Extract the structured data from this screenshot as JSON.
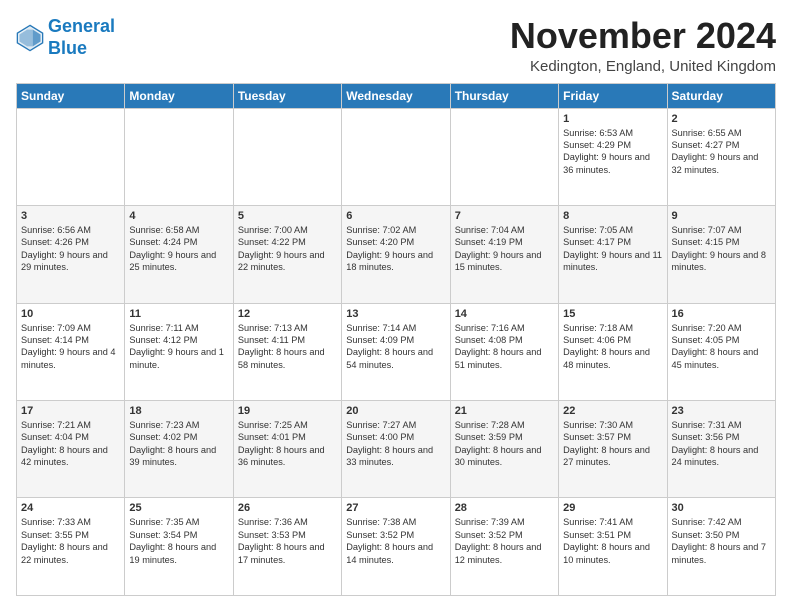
{
  "logo": {
    "line1": "General",
    "line2": "Blue"
  },
  "title": "November 2024",
  "location": "Kedington, England, United Kingdom",
  "weekdays": [
    "Sunday",
    "Monday",
    "Tuesday",
    "Wednesday",
    "Thursday",
    "Friday",
    "Saturday"
  ],
  "weeks": [
    [
      {
        "day": "",
        "info": ""
      },
      {
        "day": "",
        "info": ""
      },
      {
        "day": "",
        "info": ""
      },
      {
        "day": "",
        "info": ""
      },
      {
        "day": "",
        "info": ""
      },
      {
        "day": "1",
        "info": "Sunrise: 6:53 AM\nSunset: 4:29 PM\nDaylight: 9 hours and 36 minutes."
      },
      {
        "day": "2",
        "info": "Sunrise: 6:55 AM\nSunset: 4:27 PM\nDaylight: 9 hours and 32 minutes."
      }
    ],
    [
      {
        "day": "3",
        "info": "Sunrise: 6:56 AM\nSunset: 4:26 PM\nDaylight: 9 hours and 29 minutes."
      },
      {
        "day": "4",
        "info": "Sunrise: 6:58 AM\nSunset: 4:24 PM\nDaylight: 9 hours and 25 minutes."
      },
      {
        "day": "5",
        "info": "Sunrise: 7:00 AM\nSunset: 4:22 PM\nDaylight: 9 hours and 22 minutes."
      },
      {
        "day": "6",
        "info": "Sunrise: 7:02 AM\nSunset: 4:20 PM\nDaylight: 9 hours and 18 minutes."
      },
      {
        "day": "7",
        "info": "Sunrise: 7:04 AM\nSunset: 4:19 PM\nDaylight: 9 hours and 15 minutes."
      },
      {
        "day": "8",
        "info": "Sunrise: 7:05 AM\nSunset: 4:17 PM\nDaylight: 9 hours and 11 minutes."
      },
      {
        "day": "9",
        "info": "Sunrise: 7:07 AM\nSunset: 4:15 PM\nDaylight: 9 hours and 8 minutes."
      }
    ],
    [
      {
        "day": "10",
        "info": "Sunrise: 7:09 AM\nSunset: 4:14 PM\nDaylight: 9 hours and 4 minutes."
      },
      {
        "day": "11",
        "info": "Sunrise: 7:11 AM\nSunset: 4:12 PM\nDaylight: 9 hours and 1 minute."
      },
      {
        "day": "12",
        "info": "Sunrise: 7:13 AM\nSunset: 4:11 PM\nDaylight: 8 hours and 58 minutes."
      },
      {
        "day": "13",
        "info": "Sunrise: 7:14 AM\nSunset: 4:09 PM\nDaylight: 8 hours and 54 minutes."
      },
      {
        "day": "14",
        "info": "Sunrise: 7:16 AM\nSunset: 4:08 PM\nDaylight: 8 hours and 51 minutes."
      },
      {
        "day": "15",
        "info": "Sunrise: 7:18 AM\nSunset: 4:06 PM\nDaylight: 8 hours and 48 minutes."
      },
      {
        "day": "16",
        "info": "Sunrise: 7:20 AM\nSunset: 4:05 PM\nDaylight: 8 hours and 45 minutes."
      }
    ],
    [
      {
        "day": "17",
        "info": "Sunrise: 7:21 AM\nSunset: 4:04 PM\nDaylight: 8 hours and 42 minutes."
      },
      {
        "day": "18",
        "info": "Sunrise: 7:23 AM\nSunset: 4:02 PM\nDaylight: 8 hours and 39 minutes."
      },
      {
        "day": "19",
        "info": "Sunrise: 7:25 AM\nSunset: 4:01 PM\nDaylight: 8 hours and 36 minutes."
      },
      {
        "day": "20",
        "info": "Sunrise: 7:27 AM\nSunset: 4:00 PM\nDaylight: 8 hours and 33 minutes."
      },
      {
        "day": "21",
        "info": "Sunrise: 7:28 AM\nSunset: 3:59 PM\nDaylight: 8 hours and 30 minutes."
      },
      {
        "day": "22",
        "info": "Sunrise: 7:30 AM\nSunset: 3:57 PM\nDaylight: 8 hours and 27 minutes."
      },
      {
        "day": "23",
        "info": "Sunrise: 7:31 AM\nSunset: 3:56 PM\nDaylight: 8 hours and 24 minutes."
      }
    ],
    [
      {
        "day": "24",
        "info": "Sunrise: 7:33 AM\nSunset: 3:55 PM\nDaylight: 8 hours and 22 minutes."
      },
      {
        "day": "25",
        "info": "Sunrise: 7:35 AM\nSunset: 3:54 PM\nDaylight: 8 hours and 19 minutes."
      },
      {
        "day": "26",
        "info": "Sunrise: 7:36 AM\nSunset: 3:53 PM\nDaylight: 8 hours and 17 minutes."
      },
      {
        "day": "27",
        "info": "Sunrise: 7:38 AM\nSunset: 3:52 PM\nDaylight: 8 hours and 14 minutes."
      },
      {
        "day": "28",
        "info": "Sunrise: 7:39 AM\nSunset: 3:52 PM\nDaylight: 8 hours and 12 minutes."
      },
      {
        "day": "29",
        "info": "Sunrise: 7:41 AM\nSunset: 3:51 PM\nDaylight: 8 hours and 10 minutes."
      },
      {
        "day": "30",
        "info": "Sunrise: 7:42 AM\nSunset: 3:50 PM\nDaylight: 8 hours and 7 minutes."
      }
    ]
  ]
}
